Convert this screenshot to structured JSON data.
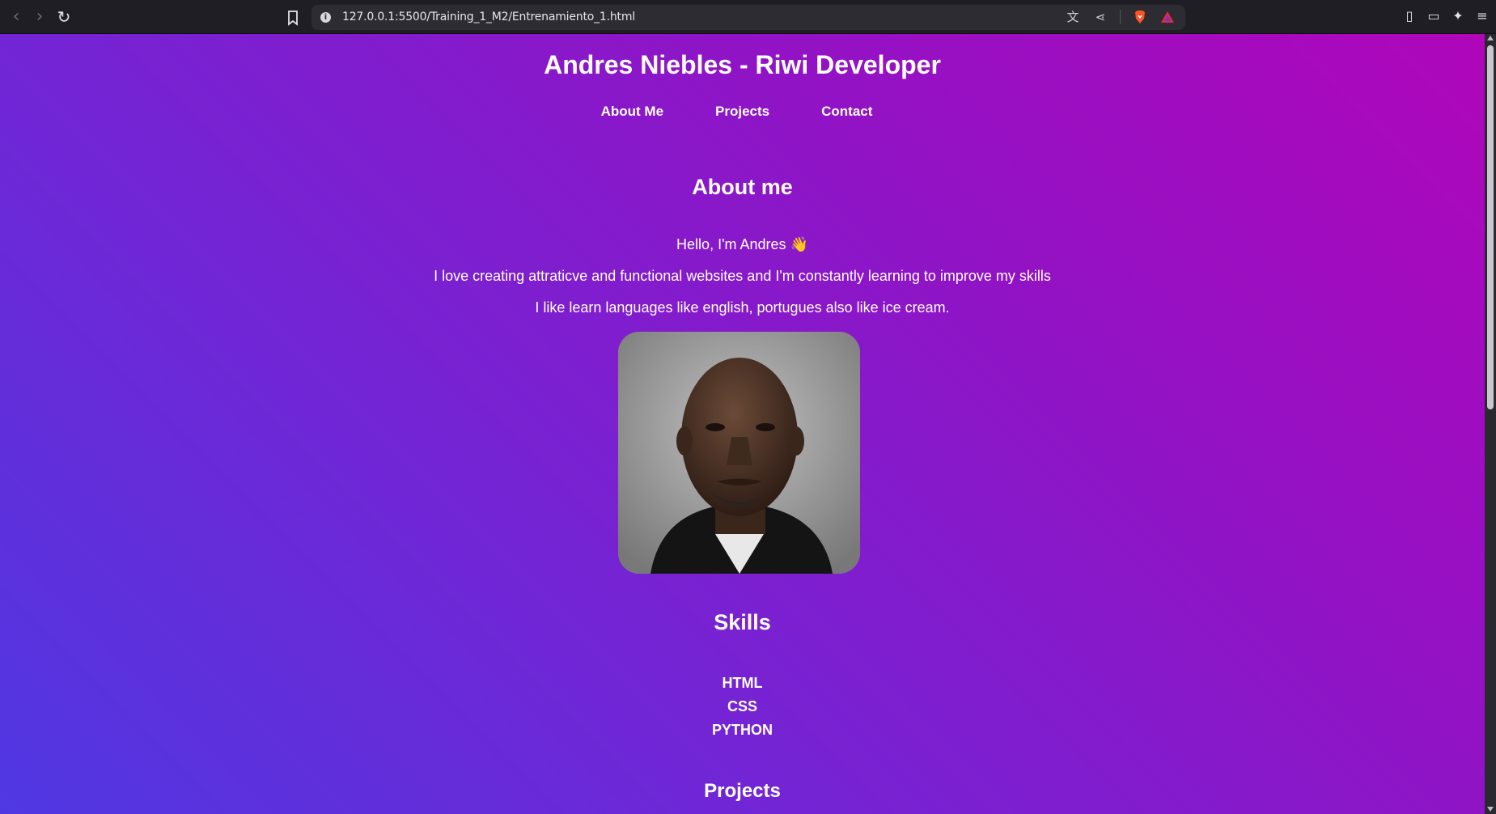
{
  "browser": {
    "url": "127.0.0.1:5500/Training_1_M2/Entrenamiento_1.html"
  },
  "site": {
    "title": "Andres Niebles - Riwi Developer",
    "nav": [
      "About Me",
      "Projects",
      "Contact"
    ]
  },
  "about": {
    "heading": "About me",
    "lines": [
      "Hello, I'm Andres 👋",
      "I love creating attraticve and functional websites and I'm constantly learning to improve my skills",
      "I like learn languages like english, portugues also like ice cream."
    ]
  },
  "skills": {
    "heading": "Skills",
    "items": [
      "HTML",
      "CSS",
      "PYTHON"
    ]
  },
  "projects": {
    "heading": "Projects"
  },
  "colors": {
    "gradient_top_right": "#b006ba",
    "gradient_bottom_left": "#4f38e2"
  }
}
